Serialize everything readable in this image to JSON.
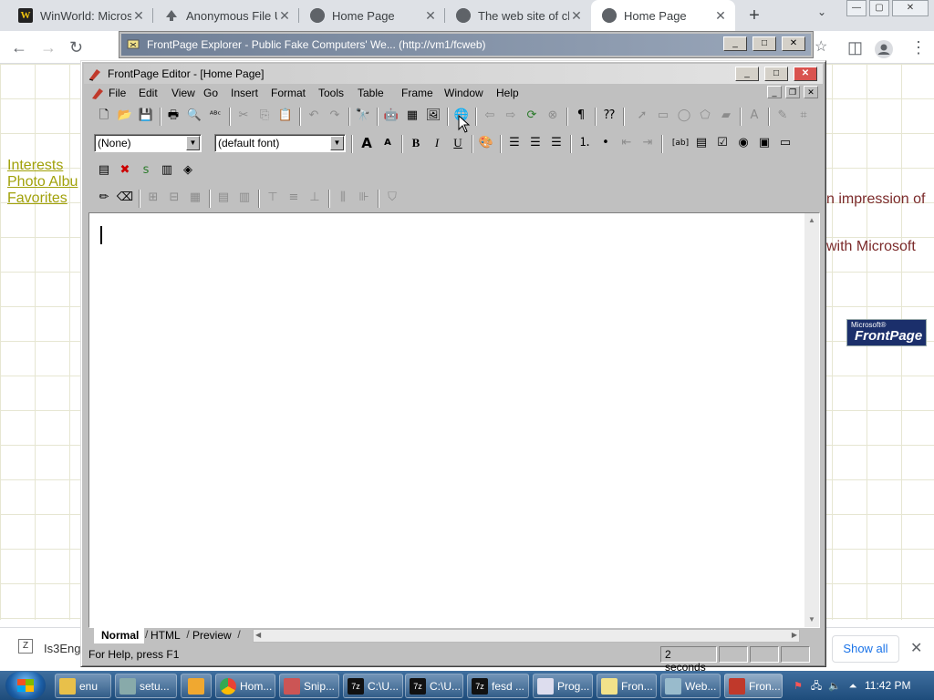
{
  "chrome": {
    "tabs": [
      {
        "title": "WinWorld: Micros",
        "icon": "winworld-favicon"
      },
      {
        "title": "Anonymous File U",
        "icon": "upload-favicon"
      },
      {
        "title": "Home Page",
        "icon": "globe-favicon"
      },
      {
        "title": "The web site of ch",
        "icon": "globe-favicon"
      },
      {
        "title": "Home Page",
        "icon": "globe-favicon",
        "active": true
      }
    ],
    "new_tab": "+",
    "window_controls": {
      "min": "—",
      "max": "▢",
      "close": "✕"
    }
  },
  "webpage": {
    "links": [
      "Interests",
      "Photo Albu",
      "Favorites"
    ],
    "right_texts": [
      "n impression of",
      "with Microsoft"
    ],
    "logo": {
      "top": "Microsoft®",
      "main": "FrontPage"
    }
  },
  "explorer": {
    "title": "FrontPage Explorer - Public Fake Computers' We... (http://vm1/fcweb)"
  },
  "editor": {
    "title": "FrontPage Editor - [Home Page]",
    "menu": [
      "File",
      "Edit",
      "View",
      "Go",
      "Insert",
      "Format",
      "Tools",
      "Table",
      "Frame",
      "Window",
      "Help"
    ],
    "style_value": "(None)",
    "font_value": "(default font)",
    "view_tabs": [
      "Normal",
      "HTML",
      "Preview"
    ],
    "active_view": "Normal",
    "status": {
      "help": "For Help, press F1",
      "time": "2 seconds"
    }
  },
  "download": {
    "name": "Is3Eng",
    "show_all": "Show all",
    "close": "✕"
  },
  "taskbar": {
    "items": [
      "enu",
      "setu...",
      "",
      "Hom...",
      "Snip...",
      "C:\\U...",
      "C:\\U...",
      "fesd ...",
      "Prog...",
      "Fron...",
      "Web...",
      "Fron..."
    ],
    "clock": "11:42 PM"
  },
  "colors": {
    "link": "#a1a10a",
    "titlebar_inactive": "#6f7f96",
    "close_red": "#d9534f",
    "taskbar": "#1e4c7b"
  }
}
